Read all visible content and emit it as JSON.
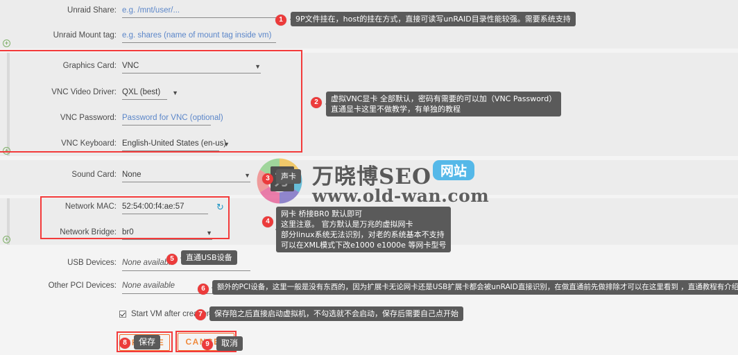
{
  "form": {
    "rows": [
      {
        "label": "Unraid Share:",
        "value": "e.g. /mnt/user/...",
        "type": "placeholder"
      },
      {
        "label": "Unraid Mount tag:",
        "value": "e.g. shares (name of mount tag inside vm)",
        "type": "placeholder"
      },
      {
        "label": "Graphics Card:",
        "value": "VNC",
        "type": "select"
      },
      {
        "label": "VNC Video Driver:",
        "value": "QXL (best)",
        "type": "select"
      },
      {
        "label": "VNC Password:",
        "value": "Password for VNC (optional)",
        "type": "placeholder"
      },
      {
        "label": "VNC Keyboard:",
        "value": "English-United States (en-us)",
        "type": "select"
      },
      {
        "label": "Sound Card:",
        "value": "None",
        "type": "select"
      },
      {
        "label": "Network MAC:",
        "value": "52:54:00:f4:ae:57",
        "type": "text"
      },
      {
        "label": "Network Bridge:",
        "value": "br0",
        "type": "select"
      },
      {
        "label": "USB Devices:",
        "value": "None available",
        "type": "none"
      },
      {
        "label": "Other PCI Devices:",
        "value": "None available",
        "type": "none"
      }
    ],
    "checkbox_label": "Start VM after creation"
  },
  "buttons": {
    "create": "CREATE",
    "cancel": "CANCEL"
  },
  "annotations": [
    {
      "num": "1",
      "lines": [
        "9P文件挂在，host的挂在方式，直接可读写unRAID目录性能较强。需要系统支持"
      ]
    },
    {
      "num": "2",
      "lines": [
        "虚拟VNC显卡 全部默认，密码有需要的可以加（VNC Password）",
        "直通显卡这里不做教学，有单独的教程"
      ]
    },
    {
      "num": "3",
      "lines": [
        "声卡"
      ]
    },
    {
      "num": "4",
      "lines": [
        "网卡 桥接BR0 默认即可",
        "这里注意。 官方默认是万兆的虚拟网卡",
        "部分linux系统无法识别，对老的系统基本不支持",
        "可以在XML模式下改e1000 e1000e 等网卡型号"
      ]
    },
    {
      "num": "5",
      "lines": [
        "直通USB设备"
      ]
    },
    {
      "num": "6",
      "lines": [
        "额外的PCI设备，这里一般是没有东西的，因为扩展卡无论网卡还是USB扩展卡都会被unRAID直接识别，在做直通前先做排除才可以在这里看到 ，直通教程有介绍"
      ]
    },
    {
      "num": "7",
      "lines": [
        "保存陪之后直接启动虚拟机，不勾选就不会启动，保存后需要自己点开始"
      ]
    },
    {
      "num": "8",
      "lines": [
        "保存"
      ]
    },
    {
      "num": "9",
      "lines": [
        "取消"
      ]
    }
  ],
  "watermark": {
    "title": "万晓博SEO",
    "badge": "网站",
    "url": "www.old-wan.com",
    "mark": "万"
  },
  "colors": {
    "accent_red": "#ec3b3b",
    "button_orange": "#f26c2a",
    "placeholder_blue": "#5b86c9",
    "tooltip_gray": "#5a5a5a",
    "plus_green": "#7fb069",
    "refresh_blue": "#2196c4",
    "badge_blue": "#55b8e8"
  }
}
